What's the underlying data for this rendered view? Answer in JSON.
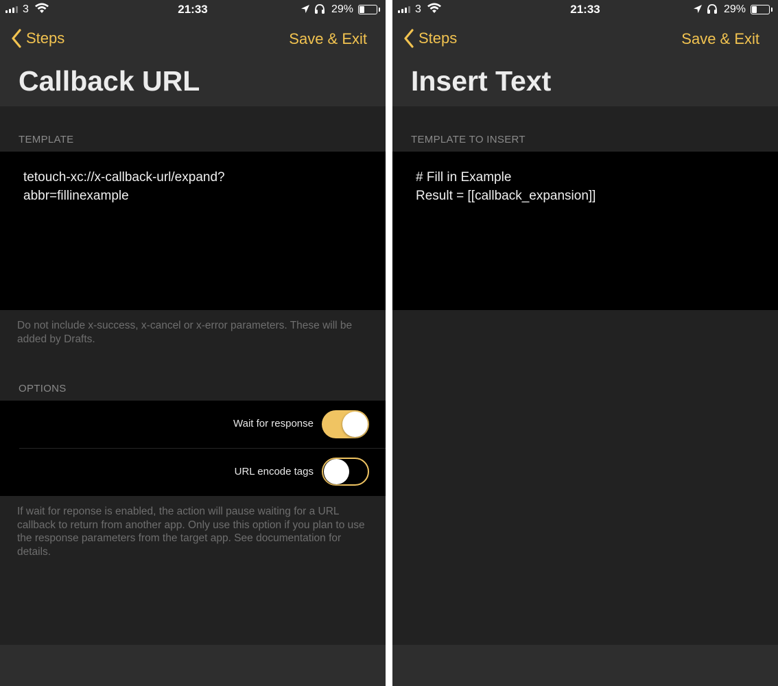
{
  "left": {
    "status": {
      "carrier": "3",
      "time": "21:33",
      "battery_pct": "29%"
    },
    "nav": {
      "back_label": "Steps",
      "save_label": "Save & Exit"
    },
    "title": "Callback URL",
    "template": {
      "section_label": "TEMPLATE",
      "text": "tetouch-xc://x-callback-url/expand?\nabbr=fillinexample"
    },
    "template_note": "Do not include x-success, x-cancel or x-error parameters. These will be added by Drafts.",
    "options": {
      "section_label": "OPTIONS",
      "items": [
        {
          "label": "Wait for response",
          "on": true
        },
        {
          "label": "URL encode tags",
          "on": false
        }
      ],
      "note": "If wait for reponse is enabled, the action will pause waiting for a URL callback to return from another app. Only use this option if you plan to use the response parameters from the target app. See documentation for details."
    }
  },
  "right": {
    "status": {
      "carrier": "3",
      "time": "21:33",
      "battery_pct": "29%"
    },
    "nav": {
      "back_label": "Steps",
      "save_label": "Save & Exit"
    },
    "title": "Insert Text",
    "template": {
      "section_label": "TEMPLATE TO INSERT",
      "text": "# Fill in Example\nResult = [[callback_expansion]]"
    }
  },
  "colors": {
    "accent": "#f2c350",
    "background": "#222222",
    "header": "#2e2e2e",
    "field": "#000000"
  },
  "icons": [
    "signal-bars-icon",
    "wifi-icon",
    "location-arrow-icon",
    "headphones-icon",
    "battery-icon",
    "chevron-left-icon"
  ]
}
